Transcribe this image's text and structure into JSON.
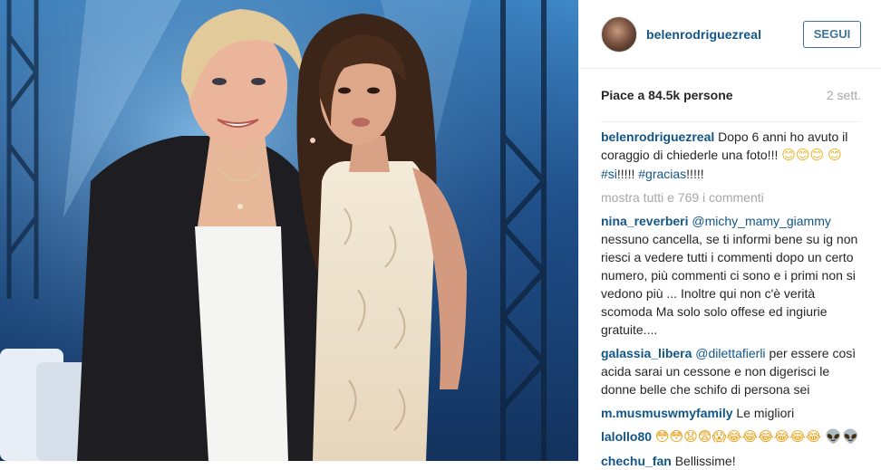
{
  "post": {
    "username": "belenrodriguezreal",
    "follow_label": "SEGUI",
    "likes": "Piace a 84.5k persone",
    "time_ago": "2 sett."
  },
  "caption": {
    "username": "belenrodriguezreal",
    "text": "Dopo 6 anni ho avuto il coraggio di chiederle una foto!!!",
    "emojis": "😊😊😊",
    "emoji2": "😊",
    "tag1": "#si",
    "after_tag1": "!!!!!",
    "tag2": "#gracias",
    "after_tag2": "!!!!!"
  },
  "show_all_comments": "mostra tutti e 769 i commenti",
  "comments": [
    {
      "username": "nina_reverberi",
      "mention": "@michy_mamy_giammy",
      "text": "nessuno cancella, se ti informi bene su ig non riesci a vedere tutti i commenti dopo un certo numero, più commenti ci sono e i primi non si vedono più ... Inoltre qui non c'è verità scomoda Ma solo solo offese ed ingiurie gratuite...."
    },
    {
      "username": "galassia_libera",
      "mention": "@dilettafierli",
      "text": "per essere così acida sarai un cessone e non digerisci le donne belle che schifo di persona sei"
    },
    {
      "username": "m.musmuswmyfamily",
      "mention": "",
      "text": "Le migliori"
    },
    {
      "username": "lalollo80",
      "mention": "",
      "text": "😳😳😧😨😱😂😂😂😂😂😂 👽👽"
    },
    {
      "username": "chechu_fan",
      "mention": "",
      "text": "Bellissime!"
    }
  ],
  "colors": {
    "username": "#125688",
    "follow_border": "#3f729b",
    "muted": "#a5a7aa",
    "text": "#262626"
  },
  "icons": {
    "avatar": "profile-photo"
  }
}
